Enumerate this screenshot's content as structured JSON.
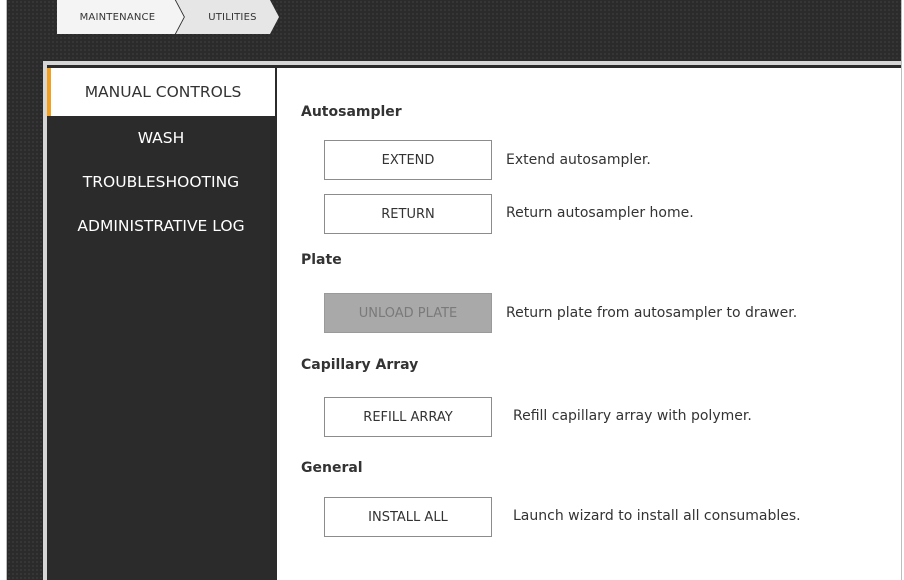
{
  "breadcrumb": {
    "items": [
      {
        "label": "MAINTENANCE"
      },
      {
        "label": "UTILITIES"
      }
    ]
  },
  "sidebar": {
    "items": [
      {
        "label": "MANUAL CONTROLS",
        "active": true
      },
      {
        "label": "WASH"
      },
      {
        "label": "TROUBLESHOOTING"
      },
      {
        "label": "ADMINISTRATIVE LOG"
      }
    ]
  },
  "main": {
    "autosampler": {
      "title": "Autosampler",
      "extend_label": "EXTEND",
      "extend_desc": "Extend autosampler.",
      "return_label": "RETURN",
      "return_desc": "Return autosampler home."
    },
    "plate": {
      "title": "Plate",
      "unload_label": "UNLOAD PLATE",
      "unload_desc": "Return plate from autosampler to drawer.",
      "unload_enabled": false
    },
    "capillary": {
      "title": "Capillary Array",
      "refill_label": "REFILL ARRAY",
      "refill_desc": "Refill capillary array with polymer."
    },
    "general": {
      "title": "General",
      "install_label": "INSTALL ALL",
      "install_desc": "Launch wizard to install all consumables."
    }
  },
  "colors": {
    "accent": "#f2a01e",
    "sidebar_bg": "#2b2b2b",
    "disabled_btn": "#a9a9a9"
  }
}
